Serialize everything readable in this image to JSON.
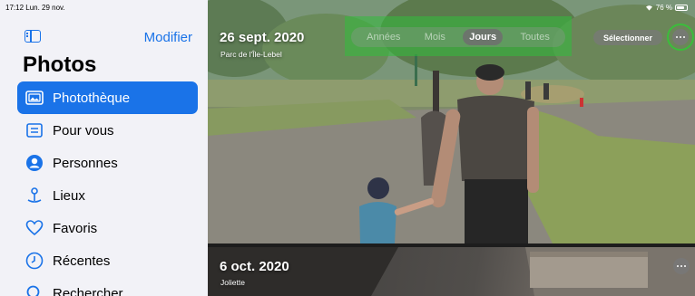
{
  "status_bar": {
    "time": "17:12  Lun. 29 nov.",
    "battery": "76 %",
    "battery_level": 0.76
  },
  "sidebar": {
    "edit_label": "Modifier",
    "title": "Photos",
    "items": [
      {
        "label": "Photothèque",
        "icon": "photo-library-icon",
        "active": true
      },
      {
        "label": "Pour vous",
        "icon": "for-you-icon",
        "active": false
      },
      {
        "label": "Personnes",
        "icon": "person-icon",
        "active": false
      },
      {
        "label": "Lieux",
        "icon": "map-pin-icon",
        "active": false
      },
      {
        "label": "Favoris",
        "icon": "heart-icon",
        "active": false
      },
      {
        "label": "Récentes",
        "icon": "clock-icon",
        "active": false
      },
      {
        "label": "Rechercher",
        "icon": "search-icon",
        "active": false
      }
    ]
  },
  "main": {
    "view_tabs": [
      "Années",
      "Mois",
      "Jours",
      "Toutes"
    ],
    "active_tab": "Jours",
    "select_label": "Sélectionner",
    "photos": [
      {
        "date": "26 sept. 2020",
        "place": "Parc de l'Île-Lebel"
      },
      {
        "date": "6 oct. 2020",
        "place": "Joliette"
      }
    ]
  },
  "colors": {
    "accent": "#1a73e8",
    "highlight": "#32be3c",
    "sidebar_bg": "#f2f2f7"
  }
}
